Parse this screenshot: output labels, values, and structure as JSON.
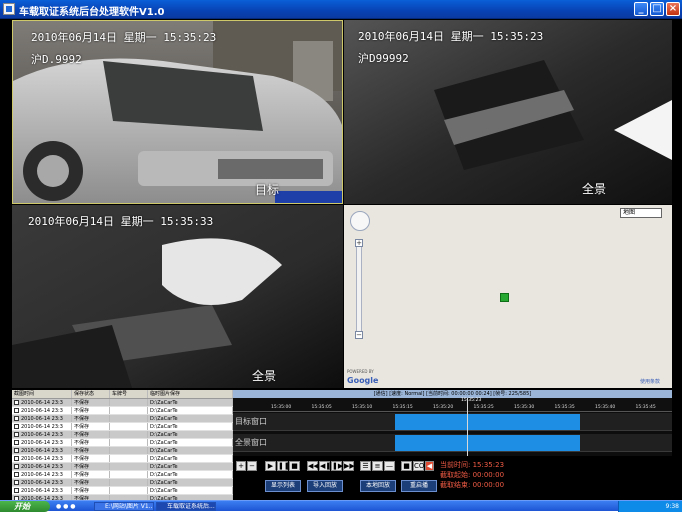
{
  "window": {
    "title": "车载取证系统后台处理软件V1.0",
    "min_label": "_",
    "max_label": "□",
    "close_label": "×"
  },
  "panes": {
    "target": {
      "timestamp": "2010年06月14日  星期一  15:35:23",
      "plate": "沪D.9992",
      "label": "目标"
    },
    "overview1": {
      "timestamp": "2010年06月14日  星期一  15:35:23",
      "plate": "沪D99992",
      "label": "全景"
    },
    "overview2": {
      "timestamp": "2010年06月14日  星期一  15:35:33",
      "label": "全景"
    }
  },
  "map": {
    "type_select": "地图",
    "logo": "Google",
    "logo_small": "POWERED BY",
    "terms": "使用条款",
    "zoom_in": "+",
    "zoom_out": "−"
  },
  "record_list": {
    "columns": [
      "截图时间",
      "保存状态",
      "车牌号",
      "临时图片保存"
    ],
    "rows": [
      [
        "2010-06-14 23:3",
        "不保存",
        "",
        "D:\\ZaCarTe"
      ],
      [
        "2010-06-14 23:3",
        "不保存",
        "",
        "D:\\ZaCarTe"
      ],
      [
        "2010-06-14 23:3",
        "不保存",
        "",
        "D:\\ZaCarTe"
      ],
      [
        "2010-06-14 23:3",
        "不保存",
        "",
        "D:\\ZaCarTe"
      ],
      [
        "2010-06-14 23:3",
        "不保存",
        "",
        "D:\\ZaCarTe"
      ],
      [
        "2010-06-14 23:3",
        "不保存",
        "",
        "D:\\ZaCarTe"
      ],
      [
        "2010-06-14 23:3",
        "不保存",
        "",
        "D:\\ZaCarTe"
      ],
      [
        "2010-06-14 23:3",
        "不保存",
        "",
        "D:\\ZaCarTe"
      ],
      [
        "2010-06-14 23:3",
        "不保存",
        "",
        "D:\\ZaCarTe"
      ],
      [
        "2010-06-14 23:3",
        "不保存",
        "",
        "D:\\ZaCarTe"
      ],
      [
        "2010-06-14 23:3",
        "不保存",
        "",
        "D:\\ZaCarTe"
      ],
      [
        "2010-06-14 23:3",
        "不保存",
        "",
        "D:\\ZaCarTe"
      ],
      [
        "2010-06-14 23:3",
        "不保存",
        "",
        "D:\\ZaCarTe"
      ]
    ]
  },
  "timeline": {
    "info": "[通信] [速度: Normal] [当前时间: 00:00:00 00:24] [帧号: 225/585]",
    "cursor_label": "15:35:23",
    "ticks": [
      "15:35:00",
      "15:35:05",
      "15:35:10",
      "15:35:15",
      "15:35:20",
      "15:35:25",
      "15:35:30",
      "15:35:35",
      "15:35:40",
      "15:35:45"
    ],
    "tracks": [
      "目标窗口",
      "全景窗口"
    ]
  },
  "controls": {
    "zoom_in": "+",
    "zoom_out": "−",
    "play": "▶",
    "pause": "❚❚",
    "stop": "■",
    "rewind": "◀◀",
    "prev_frame": "◀❚",
    "next_frame": "❚▶",
    "fast_forward": "▶▶",
    "view1": "☰",
    "view2": "≡",
    "view3": "—",
    "snapshot": "■",
    "record": "CO",
    "audio": "◀",
    "buttons": [
      "显示列表",
      "导入回放",
      "本地回放",
      "重启播"
    ],
    "current_time": "当前时间: 15:35:23",
    "clip_start": "截取起始: 00:00:00",
    "clip_end": "截取结束: 00:00:00"
  },
  "taskbar": {
    "start": "开始",
    "tasks": [
      "E:\\网站\\图片 V1...",
      "车载取证系统后..."
    ],
    "time": "9:38"
  },
  "colors": {
    "titlebar": "#0842b4",
    "timeline_fill": "#1e8ee4",
    "info_text": "#f05b45",
    "pane_border": "#cfc86a"
  }
}
